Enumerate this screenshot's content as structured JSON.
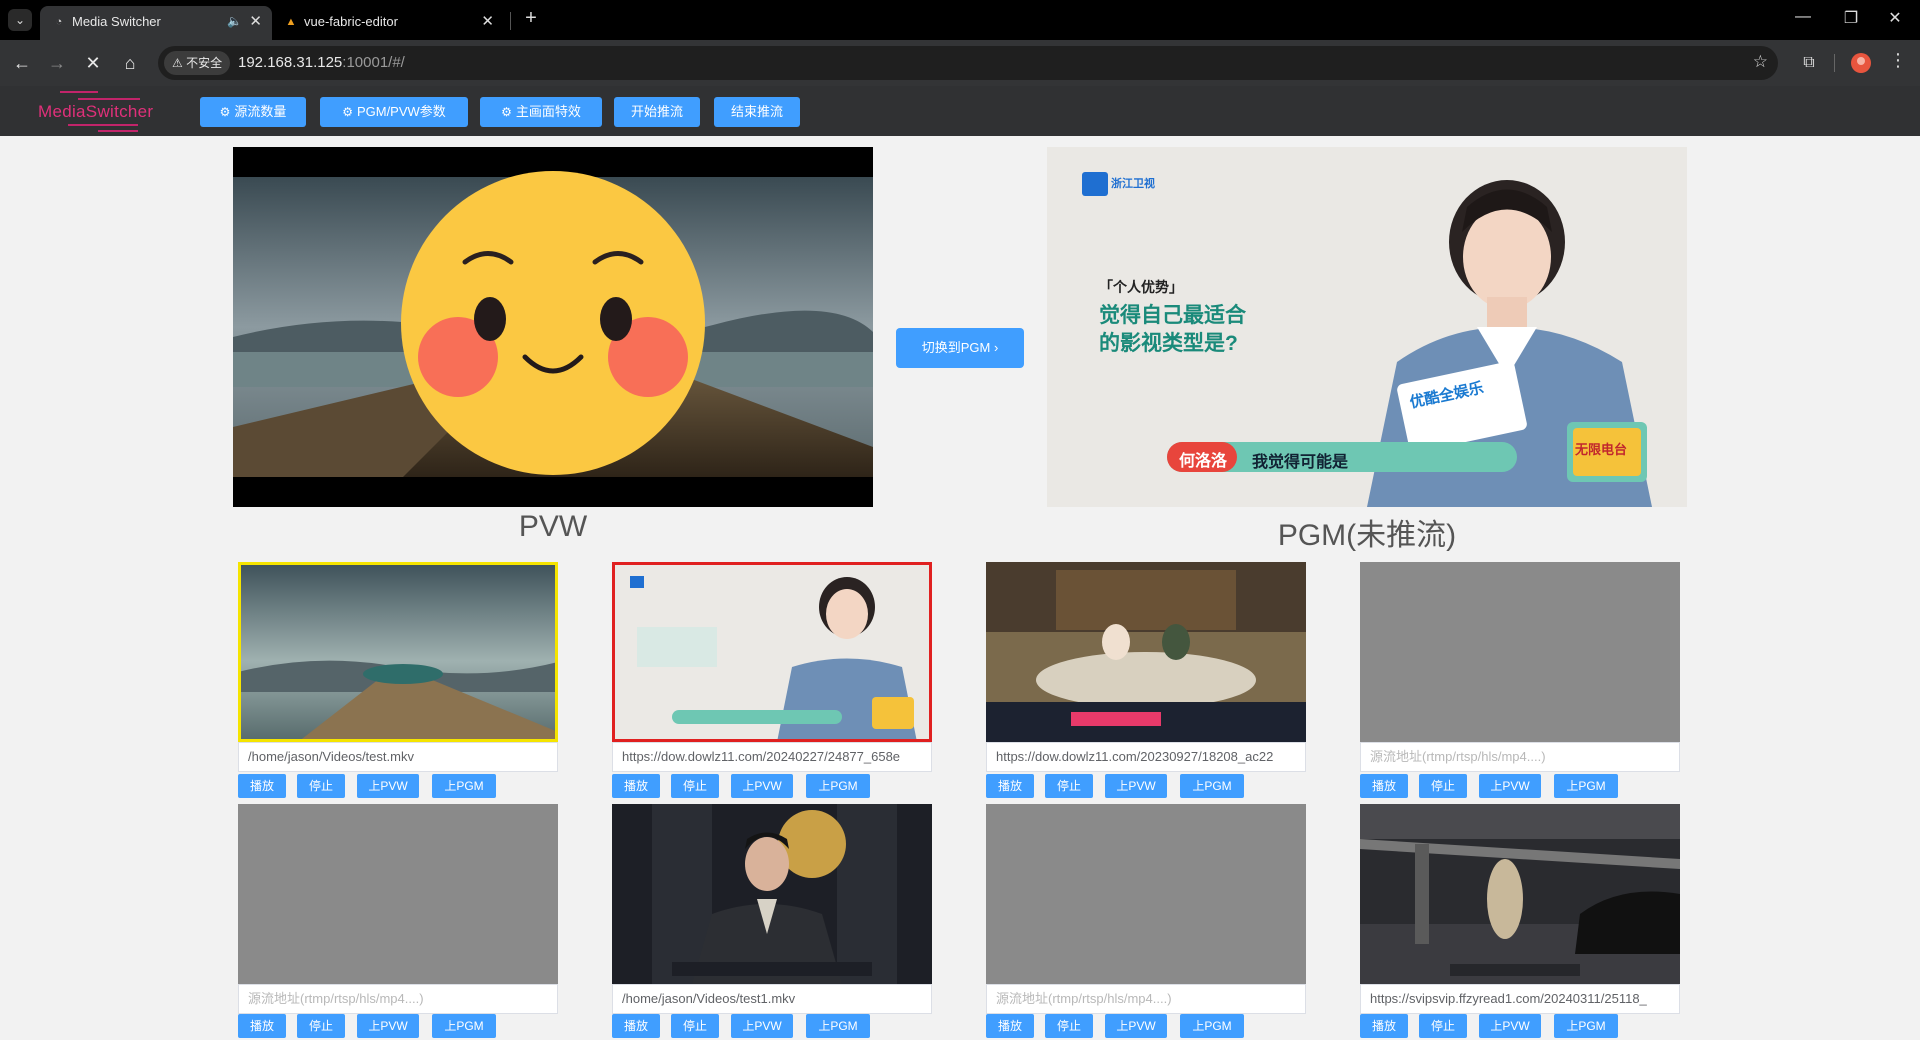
{
  "browser": {
    "tabs": [
      {
        "title": "Media Switcher",
        "active": true
      },
      {
        "title": "vue-fabric-editor",
        "active": false
      }
    ],
    "security_label": "不安全",
    "url_host": "192.168.31.125",
    "url_rest": ":10001/#/"
  },
  "app": {
    "logo_text": "MediaSwitcher",
    "buttons": {
      "sources": "源流数量",
      "params": "PGM/PVW参数",
      "effects": "主画面特效",
      "start": "开始推流",
      "stop": "结束推流"
    },
    "pvw_label": "PVW",
    "pgm_label": "PGM(未推流)",
    "switch_label": "切换到PGM",
    "pgm_overlay": {
      "channel": "浙江卫视",
      "tag": "「个人优势」",
      "question_line1": "觉得自己最适合",
      "question_line2": "的影视类型是?",
      "brand": "优酷全娱乐",
      "name": "何洛洛",
      "subtitle": "我觉得可能是",
      "show": "无限电台"
    },
    "source_actions": {
      "play": "播放",
      "stop": "停止",
      "to_pvw": "上PVW",
      "to_pgm": "上PGM"
    },
    "source_placeholder": "源流地址(rtmp/rtsp/hls/mp4....)",
    "sources": [
      {
        "url": "/home/jason/Videos/test.mkv"
      },
      {
        "url": "https://dow.dowlz11.com/20240227/24877_658e"
      },
      {
        "url": "https://dow.dowlz11.com/20230927/18208_ac22"
      },
      {
        "url": ""
      },
      {
        "url": ""
      },
      {
        "url": "/home/jason/Videos/test1.mkv"
      },
      {
        "url": ""
      },
      {
        "url": "https://svipsvip.ffzyread1.com/20240311/25118_"
      }
    ]
  }
}
